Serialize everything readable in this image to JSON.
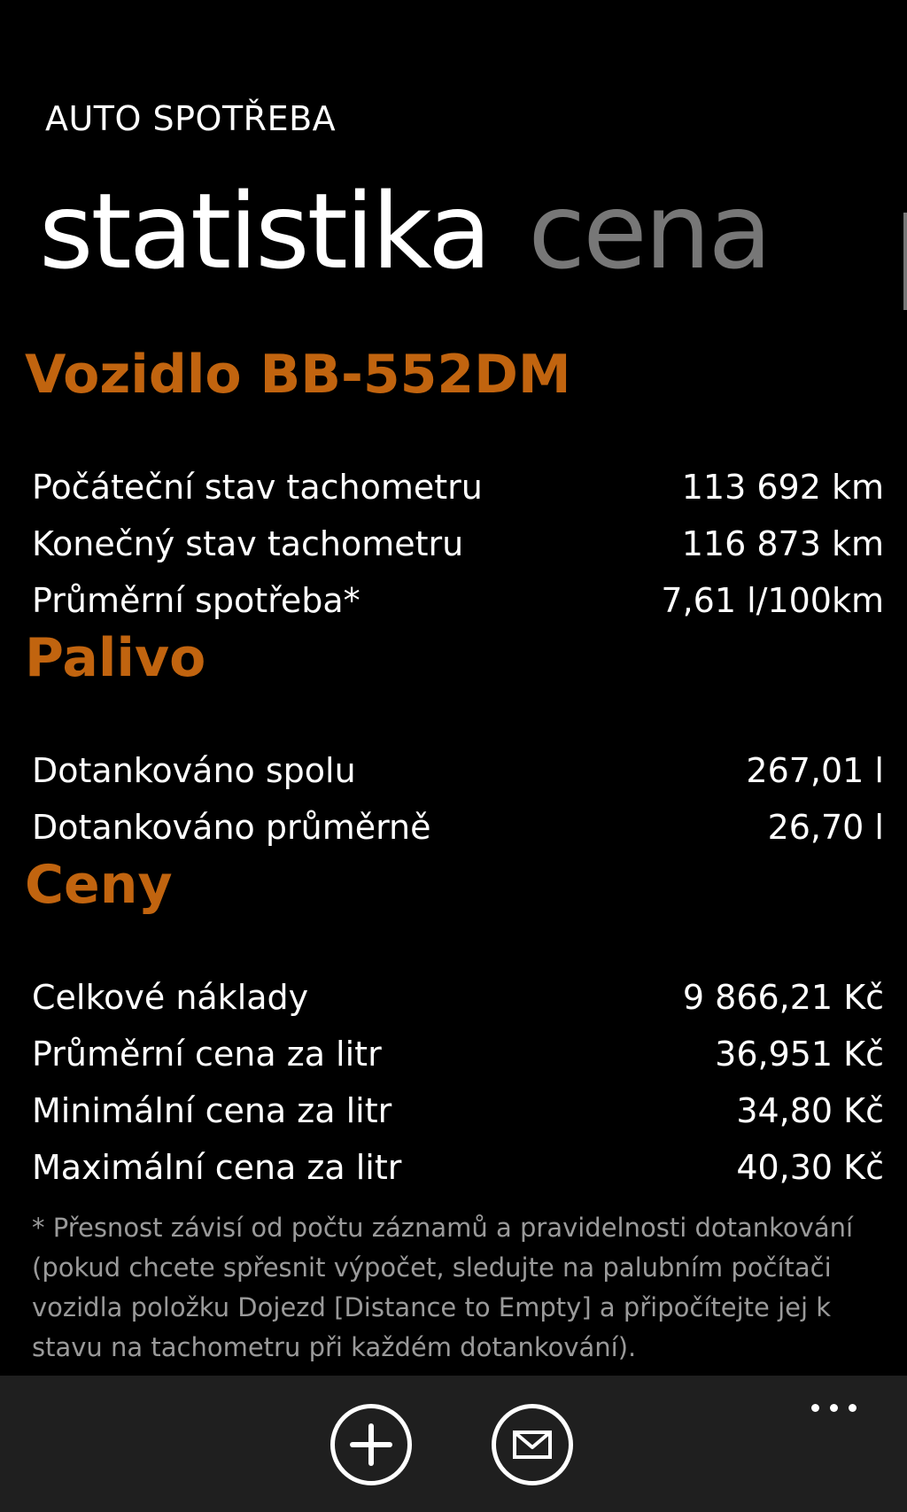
{
  "header": {
    "app_title": "AUTO SPOTŘEBA",
    "pivot": [
      {
        "label": "statistika",
        "active": true
      },
      {
        "label": "cena",
        "active": false
      }
    ]
  },
  "accent_color": "#c1640f",
  "sections": {
    "vehicle": {
      "title": "Vozidlo BB-552DM",
      "rows": [
        {
          "label": "Počáteční stav tachometru",
          "value": "113 692 km"
        },
        {
          "label": "Konečný stav tachometru",
          "value": "116 873 km"
        },
        {
          "label": "Průměrní spotřeba*",
          "value": "7,61 l/100km"
        }
      ]
    },
    "fuel": {
      "title": "Palivo",
      "rows": [
        {
          "label": "Dotankováno spolu",
          "value": "267,01 l"
        },
        {
          "label": "Dotankováno průměrně",
          "value": "26,70 l"
        }
      ]
    },
    "prices": {
      "title": "Ceny",
      "rows": [
        {
          "label": "Celkové náklady",
          "value": "9 866,21 Kč"
        },
        {
          "label": "Průměrní cena za litr",
          "value": "36,951 Kč"
        },
        {
          "label": "Minimální cena za litr",
          "value": "34,80 Kč"
        },
        {
          "label": "Maximální cena za litr",
          "value": "40,30 Kč"
        }
      ]
    }
  },
  "footnote": "* Přesnost závisí od počtu záznamů a pravidelnosti dotankování (pokud chcete spřesnit výpočet, sledujte na palubním počítači vozidla položku Dojezd [Distance to Empty] a připočítejte jej k stavu na tachometru při každém dotankování).",
  "app_bar": {
    "buttons": [
      {
        "icon": "add-icon"
      },
      {
        "icon": "mail-icon"
      }
    ],
    "more_icon": "ellipsis-icon"
  }
}
